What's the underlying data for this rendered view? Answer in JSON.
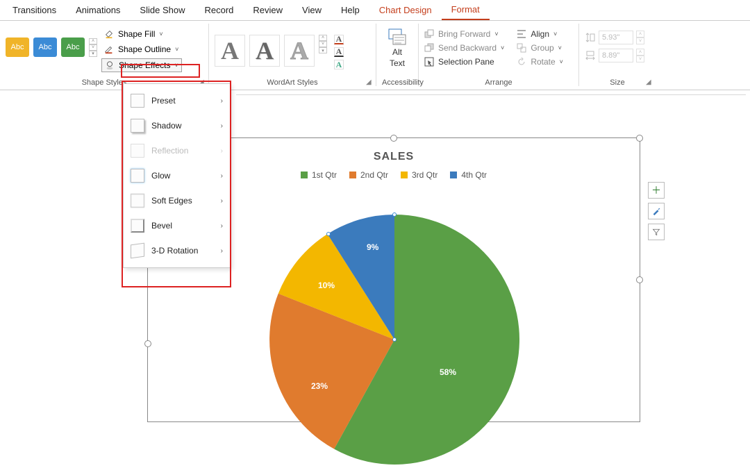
{
  "tabs": {
    "transitions": "Transitions",
    "animations": "Animations",
    "slideshow": "Slide Show",
    "record": "Record",
    "review": "Review",
    "view": "View",
    "help": "Help",
    "chartdesign": "Chart Design",
    "format": "Format"
  },
  "ribbon": {
    "shape_styles_label": "Shape Styles",
    "abc": "Abc",
    "shape_fill": "Shape Fill",
    "shape_outline": "Shape Outline",
    "shape_effects": "Shape Effects",
    "wordart_label": "WordArt Styles",
    "accessibility_label": "Accessibility",
    "alt_text_line1": "Alt",
    "alt_text_line2": "Text",
    "arrange_label": "Arrange",
    "bring_forward": "Bring Forward",
    "send_backward": "Send Backward",
    "selection_pane": "Selection Pane",
    "align": "Align",
    "group": "Group",
    "rotate": "Rotate",
    "size_label": "Size",
    "height": "5.93\"",
    "width": "8.89\""
  },
  "effects_menu": {
    "preset": "Preset",
    "shadow": "Shadow",
    "reflection": "Reflection",
    "glow": "Glow",
    "soft_edges": "Soft Edges",
    "bevel": "Bevel",
    "rotation": "3-D Rotation"
  },
  "chart": {
    "title": "SALES",
    "legend": {
      "q1": "1st Qtr",
      "q2": "2nd Qtr",
      "q3": "3rd Qtr",
      "q4": "4th Qtr"
    },
    "labels": {
      "q1": "58%",
      "q2": "23%",
      "q3": "10%",
      "q4": "9%"
    },
    "colors": {
      "q1": "#5a9f46",
      "q2": "#e07b2e",
      "q3": "#f3b700",
      "q4": "#3b7bbd"
    }
  },
  "chart_data": {
    "type": "pie",
    "title": "SALES",
    "series": [
      {
        "name": "1st Qtr",
        "value": 58,
        "color": "#5a9f46"
      },
      {
        "name": "2nd Qtr",
        "value": 23,
        "color": "#e07b2e"
      },
      {
        "name": "3rd Qtr",
        "value": 10,
        "color": "#f3b700"
      },
      {
        "name": "4th Qtr",
        "value": 9,
        "color": "#3b7bbd"
      }
    ],
    "legend_position": "top",
    "data_labels": "percentage"
  }
}
